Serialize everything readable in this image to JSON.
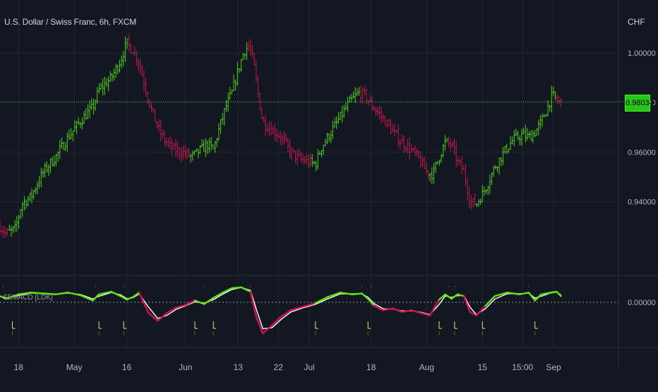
{
  "header": {
    "title": "U.S. Dollar / Swiss Franc, 6h, FXCM",
    "currency": "CHF"
  },
  "oscillator": {
    "label": "SEMACD [LDK]"
  },
  "last_price": "0.98034",
  "colors": {
    "background": "#131722",
    "up_bar": "#4fcf16",
    "down_bar": "#c2184a",
    "macd_up": "#5ee014",
    "macd_down": "#d4144a",
    "signal": "#ffffff",
    "marker_top": "#d44ad4",
    "marker_bottom": "#f7e85a",
    "last_price_line": "#3bd12a",
    "grid": "#222632"
  },
  "chart_data": [
    {
      "type": "candlestick",
      "title": "U.S. Dollar / Swiss Franc, 6h, FXCM",
      "ylabel": "CHF",
      "y_ticks": [
        1.0,
        0.98,
        0.96,
        0.94
      ],
      "y_tick_labels": [
        "1.00000",
        "0.98000",
        "0.96000",
        "0.94000"
      ],
      "ylim": [
        0.921,
        1.01
      ],
      "x_ticks": [
        {
          "label": "18",
          "x": 0.03
        },
        {
          "label": "May",
          "x": 0.12
        },
        {
          "label": "16",
          "x": 0.205
        },
        {
          "label": "Jun",
          "x": 0.3
        },
        {
          "label": "13",
          "x": 0.385
        },
        {
          "label": "22",
          "x": 0.45
        },
        {
          "label": "Jul",
          "x": 0.5
        },
        {
          "label": "18",
          "x": 0.6
        },
        {
          "label": "Aug",
          "x": 0.69
        },
        {
          "label": "15",
          "x": 0.78
        },
        {
          "label": "15:00",
          "x": 0.845
        },
        {
          "label": "Sep",
          "x": 0.895
        }
      ],
      "last_price": 0.98034,
      "price_path": [
        [
          0.0,
          0.93
        ],
        [
          0.01,
          0.927
        ],
        [
          0.025,
          0.929
        ],
        [
          0.035,
          0.939
        ],
        [
          0.05,
          0.942
        ],
        [
          0.07,
          0.952
        ],
        [
          0.09,
          0.958
        ],
        [
          0.11,
          0.966
        ],
        [
          0.135,
          0.974
        ],
        [
          0.15,
          0.978
        ],
        [
          0.16,
          0.985
        ],
        [
          0.18,
          0.99
        ],
        [
          0.195,
          0.997
        ],
        [
          0.205,
          1.004
        ],
        [
          0.215,
          1.001
        ],
        [
          0.225,
          0.996
        ],
        [
          0.235,
          0.986
        ],
        [
          0.245,
          0.977
        ],
        [
          0.255,
          0.97
        ],
        [
          0.265,
          0.965
        ],
        [
          0.28,
          0.961
        ],
        [
          0.295,
          0.96
        ],
        [
          0.31,
          0.958
        ],
        [
          0.325,
          0.961
        ],
        [
          0.335,
          0.963
        ],
        [
          0.345,
          0.961
        ],
        [
          0.355,
          0.97
        ],
        [
          0.365,
          0.978
        ],
        [
          0.375,
          0.984
        ],
        [
          0.385,
          0.993
        ],
        [
          0.395,
          1.001
        ],
        [
          0.403,
          1.003
        ],
        [
          0.41,
          0.996
        ],
        [
          0.418,
          0.982
        ],
        [
          0.425,
          0.972
        ],
        [
          0.44,
          0.969
        ],
        [
          0.455,
          0.966
        ],
        [
          0.47,
          0.96
        ],
        [
          0.485,
          0.957
        ],
        [
          0.5,
          0.956
        ],
        [
          0.51,
          0.955
        ],
        [
          0.52,
          0.962
        ],
        [
          0.535,
          0.968
        ],
        [
          0.55,
          0.974
        ],
        [
          0.565,
          0.98
        ],
        [
          0.58,
          0.984
        ],
        [
          0.59,
          0.983
        ],
        [
          0.6,
          0.979
        ],
        [
          0.615,
          0.975
        ],
        [
          0.63,
          0.97
        ],
        [
          0.645,
          0.965
        ],
        [
          0.66,
          0.962
        ],
        [
          0.675,
          0.958
        ],
        [
          0.69,
          0.952
        ],
        [
          0.7,
          0.951
        ],
        [
          0.71,
          0.958
        ],
        [
          0.72,
          0.964
        ],
        [
          0.73,
          0.963
        ],
        [
          0.74,
          0.956
        ],
        [
          0.75,
          0.952
        ],
        [
          0.76,
          0.94
        ],
        [
          0.77,
          0.939
        ],
        [
          0.78,
          0.943
        ],
        [
          0.79,
          0.948
        ],
        [
          0.8,
          0.954
        ],
        [
          0.815,
          0.96
        ],
        [
          0.83,
          0.965
        ],
        [
          0.845,
          0.967
        ],
        [
          0.855,
          0.966
        ],
        [
          0.865,
          0.968
        ],
        [
          0.875,
          0.972
        ],
        [
          0.885,
          0.978
        ],
        [
          0.893,
          0.983
        ],
        [
          0.9,
          0.981
        ],
        [
          0.907,
          0.98
        ]
      ]
    },
    {
      "type": "line",
      "title": "SEMACD [LDK]",
      "y_tick_labels": [
        "0.00000"
      ],
      "series": [
        {
          "name": "macd",
          "points": [
            [
              0.0,
              0.35
            ],
            [
              0.01,
              0.2
            ],
            [
              0.03,
              0.45
            ],
            [
              0.05,
              0.55
            ],
            [
              0.07,
              0.5
            ],
            [
              0.09,
              0.45
            ],
            [
              0.11,
              0.55
            ],
            [
              0.13,
              0.4
            ],
            [
              0.15,
              0.1
            ],
            [
              0.16,
              0.45
            ],
            [
              0.18,
              0.6
            ],
            [
              0.195,
              0.35
            ],
            [
              0.205,
              0.15
            ],
            [
              0.215,
              0.3
            ],
            [
              0.225,
              0.55
            ],
            [
              0.24,
              -0.6
            ],
            [
              0.255,
              -1.05
            ],
            [
              0.27,
              -0.6
            ],
            [
              0.285,
              -0.3
            ],
            [
              0.3,
              -0.15
            ],
            [
              0.315,
              0.1
            ],
            [
              0.33,
              -0.1
            ],
            [
              0.345,
              0.25
            ],
            [
              0.36,
              0.55
            ],
            [
              0.375,
              0.8
            ],
            [
              0.39,
              0.85
            ],
            [
              0.405,
              0.6
            ],
            [
              0.415,
              -0.9
            ],
            [
              0.425,
              -1.75
            ],
            [
              0.44,
              -1.3
            ],
            [
              0.455,
              -0.8
            ],
            [
              0.47,
              -0.45
            ],
            [
              0.49,
              -0.25
            ],
            [
              0.51,
              -0.05
            ],
            [
              0.53,
              0.3
            ],
            [
              0.55,
              0.55
            ],
            [
              0.57,
              0.45
            ],
            [
              0.585,
              0.5
            ],
            [
              0.595,
              0.2
            ],
            [
              0.605,
              -0.2
            ],
            [
              0.62,
              -0.45
            ],
            [
              0.635,
              -0.35
            ],
            [
              0.65,
              -0.55
            ],
            [
              0.665,
              -0.45
            ],
            [
              0.68,
              -0.6
            ],
            [
              0.695,
              -0.75
            ],
            [
              0.71,
              0.15
            ],
            [
              0.72,
              0.45
            ],
            [
              0.73,
              0.2
            ],
            [
              0.74,
              0.45
            ],
            [
              0.75,
              0.35
            ],
            [
              0.76,
              -0.55
            ],
            [
              0.77,
              -0.75
            ],
            [
              0.785,
              -0.2
            ],
            [
              0.8,
              0.35
            ],
            [
              0.82,
              0.55
            ],
            [
              0.84,
              0.45
            ],
            [
              0.855,
              0.55
            ],
            [
              0.865,
              0.1
            ],
            [
              0.875,
              0.45
            ],
            [
              0.89,
              0.55
            ],
            [
              0.9,
              0.6
            ],
            [
              0.907,
              0.35
            ]
          ]
        }
      ],
      "top_markers": [
        0.005,
        0.155,
        0.2,
        0.33,
        0.405,
        0.585,
        0.6,
        0.725,
        0.735,
        0.855
      ],
      "bottom_markers": [
        0.02,
        0.16,
        0.2,
        0.315,
        0.345,
        0.51,
        0.595,
        0.71,
        0.735,
        0.78,
        0.865
      ]
    }
  ]
}
